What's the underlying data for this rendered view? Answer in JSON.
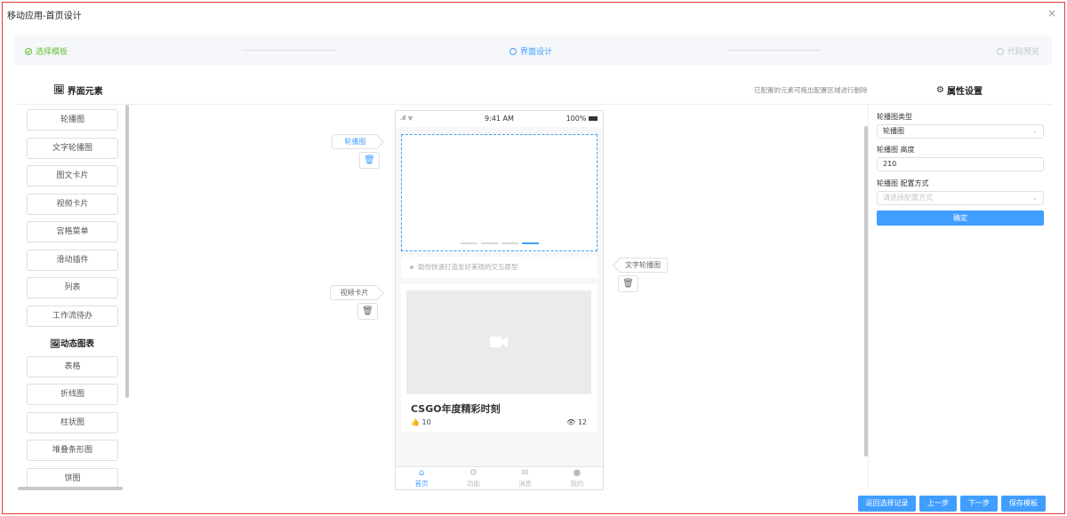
{
  "window": {
    "title": "移动应用-首页设计",
    "close": "×"
  },
  "steps": [
    {
      "label": "选择模板",
      "state": "done"
    },
    {
      "label": "界面设计",
      "state": "active"
    },
    {
      "label": "代码预览",
      "state": "pending"
    }
  ],
  "left_panel": {
    "header": "界面元素",
    "items": [
      "轮播图",
      "文字轮播图",
      "图文卡片",
      "视频卡片",
      "宫格菜单",
      "滑动插件",
      "列表",
      "工作流待办"
    ],
    "chart_header": "动态图表",
    "chart_items": [
      "表格",
      "折线图",
      "柱状图",
      "堆叠条形图",
      "饼图"
    ]
  },
  "canvas": {
    "note": "已配置的元素可拖出配置区域进行删除",
    "phone": {
      "time": "9:41 AM",
      "battery": "100%",
      "text_carousel": "助你快速打造友好美观的交互原型",
      "video_title": "CSGO年度精彩时刻",
      "likes": "10",
      "views": "12",
      "tabs": [
        "首页",
        "功能",
        "消息",
        "我的"
      ]
    },
    "tags": {
      "carousel": "轮播图",
      "text_carousel": "文字轮播图",
      "video_card": "视频卡片"
    }
  },
  "properties": {
    "header": "属性设置",
    "type_label": "轮播图类型",
    "type_value": "轮播图",
    "height_label": "轮播图 高度",
    "height_value": "210",
    "config_label": "轮播图 配置方式",
    "config_placeholder": "请选择配置方式",
    "confirm": "确定"
  },
  "footer": {
    "back_to_record": "返回选择记录",
    "prev": "上一步",
    "next": "下一步",
    "save": "保存模板"
  },
  "colors": {
    "accent": "#409eff",
    "success": "#67c23a",
    "frame": "#e53935"
  }
}
